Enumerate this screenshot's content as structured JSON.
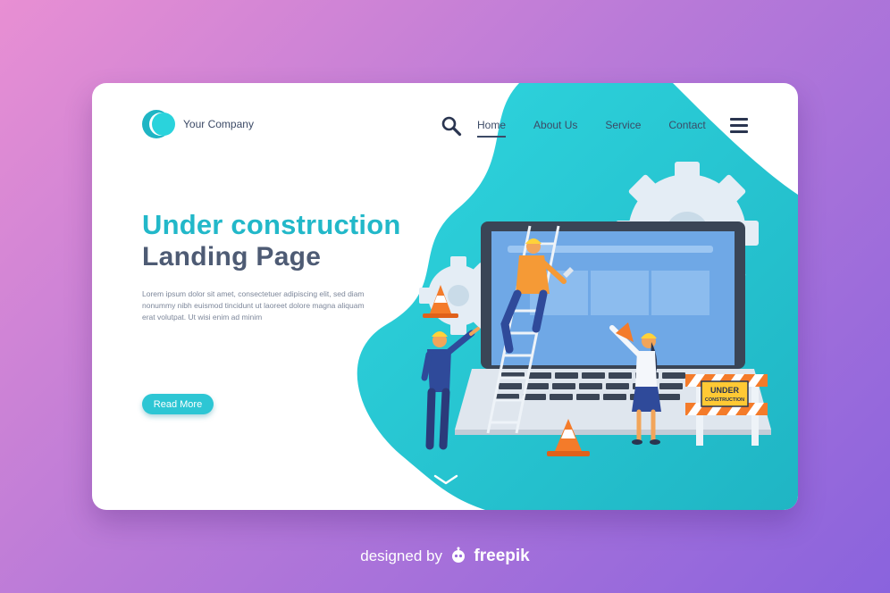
{
  "brand": {
    "company_name": "Your Company"
  },
  "nav": {
    "items": [
      {
        "label": "Home",
        "active": true
      },
      {
        "label": "About Us",
        "active": false
      },
      {
        "label": "Service",
        "active": false
      },
      {
        "label": "Contact",
        "active": false
      }
    ]
  },
  "hero": {
    "title": "Under construction",
    "subtitle": "Landing Page",
    "body": "Lorem ipsum dolor sit amet, consectetuer adipiscing elit, sed diam nonummy nibh euismod tincidunt ut laoreet dolore magna aliquam erat volutpat. Ut wisi enim ad minim",
    "cta_label": "Read More"
  },
  "illustration": {
    "sign_line1": "UNDER",
    "sign_line2": "CONSTRUCTION"
  },
  "footer": {
    "designed_by": "designed by",
    "brand": "freepik"
  },
  "colors": {
    "accent": "#22b8c9",
    "button": "#2dc6d4",
    "text_dark": "#4e5b74",
    "background_from": "#e88fd3",
    "background_to": "#8a63dd"
  },
  "icons": [
    "search-icon",
    "hamburger-menu-icon",
    "chevron-down-icon",
    "freepik-robot-icon"
  ]
}
